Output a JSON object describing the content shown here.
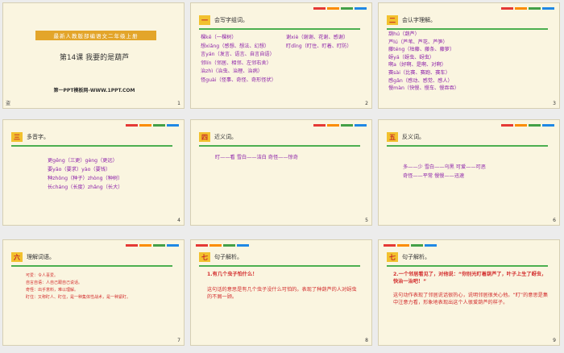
{
  "colors": {
    "red": "#d32f2f",
    "purple": "#8e24aa",
    "green": "#4caf50",
    "yellow": "#f2c12e"
  },
  "slides": [
    {
      "num": "1",
      "banner": "最新人教版部编语文二年级上册",
      "lesson": "第14课 我要的是葫芦",
      "site": "第一PPT模板网-WWW.1PPT.COM",
      "tag": "盗"
    },
    {
      "num": "2",
      "badge": "一",
      "title": "会写字组词。",
      "left": [
        "棵kē（一棵树）",
        "想xiǎng（感想、想法、幻想）",
        "言yán（发言、语言、自言自语）",
        "邻lín（邻居、相邻、左邻右舍）",
        "治zhì（治虫、治理、治病）",
        "怪guài（怪事、奇怪、奇形怪状）"
      ],
      "right": [
        "谢xiè（谢谢、花谢、感谢）",
        "盯dīng（盯住、盯着、盯防）"
      ]
    },
    {
      "num": "3",
      "badge": "二",
      "title": "会认字理解。",
      "items": [
        "葫hú（葫芦）",
        "芦lú（芦苇、芦花、芦笋）",
        "藤téng（枯藤、藤条、藤萝）",
        "蚜yá（蚜虫、蚜虫）",
        "啊a（好啊、是啊、对啊）",
        "赛sài（比赛、赛跑、赛车）",
        "感gǎn（感动、感觉、感人）",
        "慢màn（快慢、慢车、慢吞吞）"
      ]
    },
    {
      "num": "4",
      "badge": "三",
      "title": "多音字。",
      "items": [
        "更gēng（三更）gèng（更远）",
        "要yāo（要求）yào（要钱）",
        "种zhǒng（种子）zhòng（种树）",
        "长cháng（长度）zhǎng（长大）"
      ]
    },
    {
      "num": "5",
      "badge": "四",
      "title": "近义词。",
      "items": [
        "盯——看 雪白——洁白 奇怪——惊奇"
      ]
    },
    {
      "num": "6",
      "badge": "五",
      "title": "反义词。",
      "items": [
        "多——少 雪白——乌黑 可爱——可恶",
        "奇怪——平常 慢慢——迅速"
      ]
    },
    {
      "num": "7",
      "badge": "六",
      "title": "理解词语。",
      "items": [
        "可爱：令人喜爱。",
        "自言自语：人自己跟自己说话。",
        "奇怪：出乎意料，难以理解。",
        "盯住：又称盯人、盯住，是一种集体性战术，是一种紧盯。"
      ]
    },
    {
      "num": "8",
      "badge": "七",
      "title": "句子解析。",
      "items": [
        "1.有几个虫子怕什么！",
        "这句话的意思是有几个虫子没什么可怕的。表现了种葫芦的人对蚜虫的不屑一顾。"
      ]
    },
    {
      "num": "9",
      "badge": "七",
      "title": "句子解析。",
      "items": [
        "2.一个邻居看见了，对他说：“你别光盯着葫芦了，叶子上生了蚜虫，快治一治吧！”",
        "这句动作表现了邻居说话很热心，说明邻居很关心他。“盯”的意思是集中注意力看，形象地表现出这个人很爱葫芦的样子。"
      ]
    }
  ]
}
